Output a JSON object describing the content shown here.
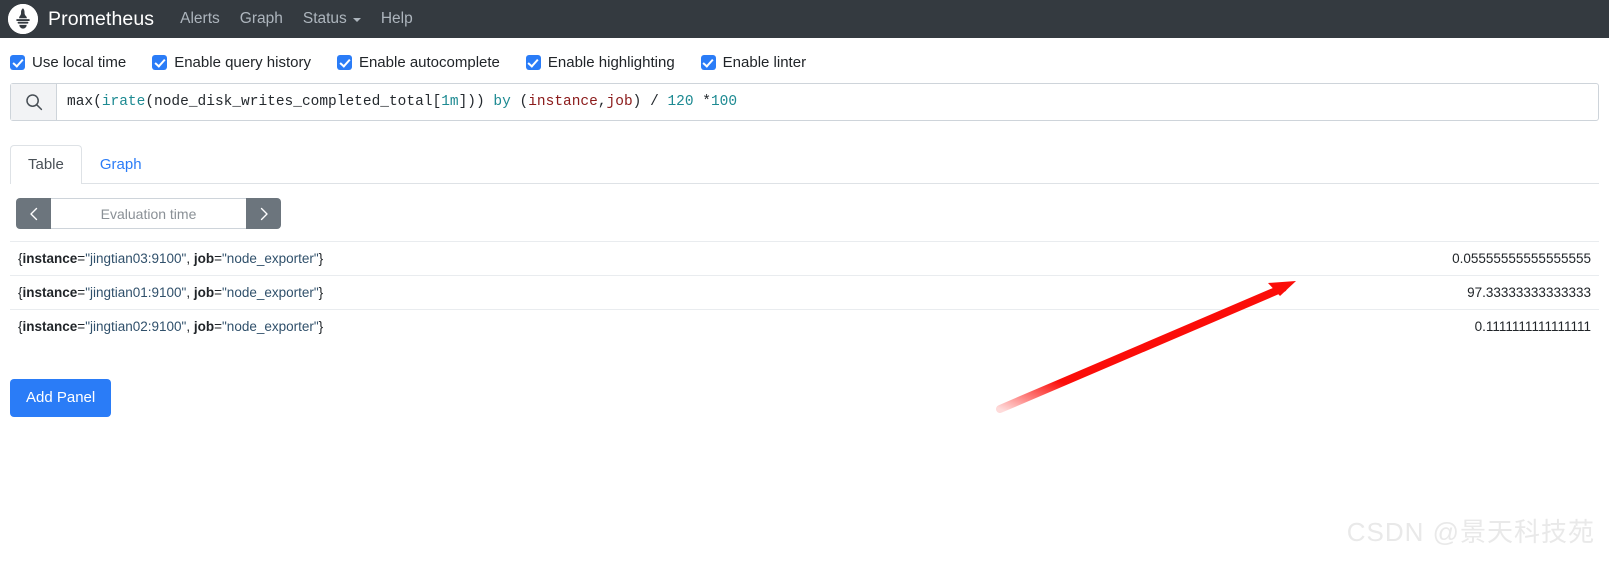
{
  "navbar": {
    "logo_icon": "prometheus-logo-icon",
    "brand": "Prometheus",
    "items": [
      {
        "label": "Alerts",
        "has_caret": false
      },
      {
        "label": "Graph",
        "has_caret": false
      },
      {
        "label": "Status",
        "has_caret": true
      },
      {
        "label": "Help",
        "has_caret": false
      }
    ],
    "background": "#343a40",
    "link_color": "#adb5bd"
  },
  "options": {
    "accent": "#2a7cf7",
    "items": [
      {
        "label": "Use local time",
        "checked": true
      },
      {
        "label": "Enable query history",
        "checked": true
      },
      {
        "label": "Enable autocomplete",
        "checked": true
      },
      {
        "label": "Enable highlighting",
        "checked": true
      },
      {
        "label": "Enable linter",
        "checked": true
      }
    ]
  },
  "query": {
    "icon": "search-icon",
    "expression": "max(irate(node_disk_writes_completed_total[1m])) by (instance,job) / 120 *100",
    "tokens": [
      {
        "text": "max",
        "type": "plain"
      },
      {
        "text": "(",
        "type": "plain"
      },
      {
        "text": "irate",
        "type": "func"
      },
      {
        "text": "(node_disk_writes_completed_total[",
        "type": "plain"
      },
      {
        "text": "1m",
        "type": "dur"
      },
      {
        "text": "])) ",
        "type": "plain"
      },
      {
        "text": "by",
        "type": "kw"
      },
      {
        "text": " (",
        "type": "plain"
      },
      {
        "text": "instance",
        "type": "label"
      },
      {
        "text": ",",
        "type": "plain"
      },
      {
        "text": "job",
        "type": "label"
      },
      {
        "text": ") ",
        "type": "plain"
      },
      {
        "text": "/",
        "type": "op"
      },
      {
        "text": " ",
        "type": "plain"
      },
      {
        "text": "120",
        "type": "num"
      },
      {
        "text": " ",
        "type": "plain"
      },
      {
        "text": "*",
        "type": "op"
      },
      {
        "text": "100",
        "type": "num"
      }
    ]
  },
  "tabs": [
    {
      "label": "Table",
      "active": true
    },
    {
      "label": "Graph",
      "active": false
    }
  ],
  "eval_time": {
    "prev_icon": "chevron-left-icon",
    "next_icon": "chevron-right-icon",
    "placeholder": "Evaluation time",
    "value": ""
  },
  "results": {
    "rows": [
      {
        "metric_prefix": "{",
        "labels": [
          {
            "name": "instance",
            "value": "\"jingtian03:9100\""
          },
          {
            "name": "job",
            "value": "\"node_exporter\""
          }
        ],
        "metric_suffix": "}",
        "value": "0.05555555555555555"
      },
      {
        "metric_prefix": "{",
        "labels": [
          {
            "name": "instance",
            "value": "\"jingtian01:9100\""
          },
          {
            "name": "job",
            "value": "\"node_exporter\""
          }
        ],
        "metric_suffix": "}",
        "value": "97.33333333333333"
      },
      {
        "metric_prefix": "{",
        "labels": [
          {
            "name": "instance",
            "value": "\"jingtian02:9100\""
          },
          {
            "name": "job",
            "value": "\"node_exporter\""
          }
        ],
        "metric_suffix": "}",
        "value": "0.1111111111111111"
      }
    ]
  },
  "add_panel": {
    "label": "Add Panel",
    "color": "#2a7cf7"
  },
  "annotation": {
    "type": "arrow",
    "color": "#fb0d09"
  },
  "watermark": {
    "text": "CSDN @景天科技苑",
    "color": "#e9e9e9"
  }
}
